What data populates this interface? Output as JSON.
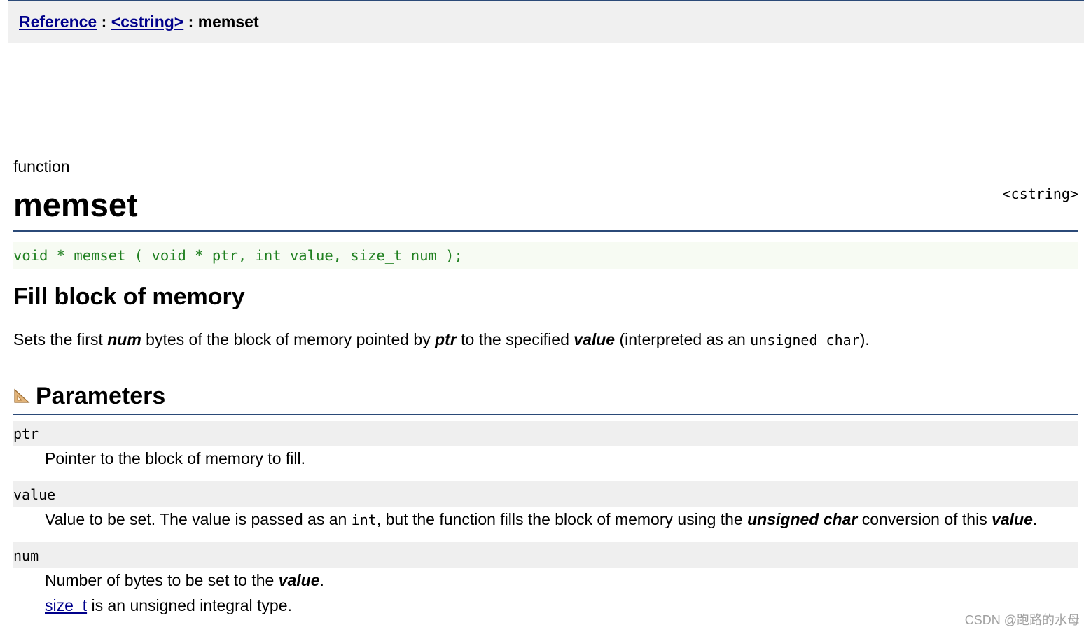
{
  "breadcrumb": {
    "reference_link": "Reference",
    "separator": ":",
    "header_link": "<cstring>",
    "current": "memset"
  },
  "entry": {
    "kind": "function",
    "name": "memset",
    "header_tag": "<cstring>",
    "prototype": "void * memset ( void * ptr, int value, size_t num );",
    "subtitle": "Fill block of memory"
  },
  "description": {
    "t1": "Sets the first ",
    "b1": "num",
    "t2": " bytes of the block of memory pointed by ",
    "b2": "ptr",
    "t3": " to the specified ",
    "b3": "value",
    "t4": " (interpreted as an ",
    "code": "unsigned char",
    "t5": ")."
  },
  "parameters": {
    "heading": "Parameters",
    "icon": "ruler-icon",
    "ptr": {
      "name": "ptr",
      "desc": "Pointer to the block of memory to fill."
    },
    "value": {
      "name": "value",
      "d1": "Value to be set. The value is passed as an ",
      "code": "int",
      "d2": ", but the function fills the block of memory using the ",
      "b1": "unsigned char",
      "d3": " conversion of this ",
      "b2": "value",
      "d4": "."
    },
    "num": {
      "name": "num",
      "d1": "Number of bytes to be set to the ",
      "b1": "value",
      "d2": ".",
      "link": "size_t",
      "d3": " is an unsigned integral type."
    }
  },
  "watermark": "CSDN @跑路的水母",
  "colors": {
    "accent_rule": "#2b4a78",
    "prototype_text": "#208020",
    "prototype_bg": "#f7fbf3",
    "param_bg": "#efefef",
    "link": "#00008b"
  }
}
